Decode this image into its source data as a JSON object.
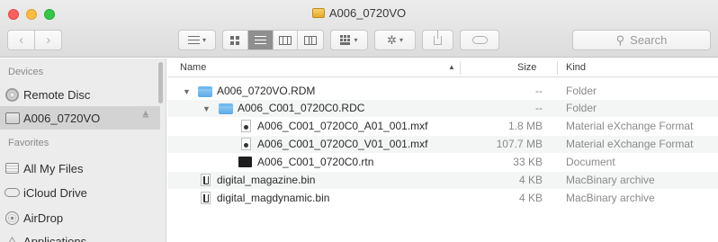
{
  "window": {
    "title": "A006_0720VO"
  },
  "toolbar": {
    "back_glyph": "‹",
    "forward_glyph": "›",
    "gear_glyph": "✲",
    "caret": "▾",
    "search_placeholder": "Search",
    "search_glyph": "⚲",
    "icons": [
      "back-icon",
      "forward-icon",
      "arrange-icon",
      "icon-view-icon",
      "list-view-icon",
      "column-view-icon",
      "cover-flow-icon",
      "group-icon",
      "gear-icon",
      "share-icon",
      "tag-icon",
      "search-icon"
    ]
  },
  "sidebar": {
    "devices_header": "Devices",
    "favorites_header": "Favorites",
    "eject_glyph": "≜",
    "devices": [
      {
        "label": "Remote Disc",
        "icon": "disc-icon"
      },
      {
        "label": "A006_0720VO",
        "icon": "drive-icon",
        "selected": true
      }
    ],
    "favorites": [
      {
        "label": "All My Files",
        "icon": "all-my-files-icon"
      },
      {
        "label": "iCloud Drive",
        "icon": "cloud-icon"
      },
      {
        "label": "AirDrop",
        "icon": "airdrop-icon"
      },
      {
        "label": "Applications",
        "icon": "applications-icon",
        "glyph": "⨺"
      }
    ]
  },
  "list": {
    "columns": {
      "name": "Name",
      "size": "Size",
      "kind": "Kind"
    },
    "sort_glyph": "▲",
    "expanded_glyph": "▼",
    "rows": [
      {
        "name": "A006_0720VO.RDM",
        "size": "--",
        "kind": "Folder",
        "icon": "folder-icon"
      },
      {
        "name": "A006_C001_0720C0.RDC",
        "size": "--",
        "kind": "Folder",
        "icon": "folder-icon"
      },
      {
        "name": "A006_C001_0720C0_A01_001.mxf",
        "size": "1.8 MB",
        "kind": "Material eXchange Format",
        "icon": "mxf-file-icon"
      },
      {
        "name": "A006_C001_0720C0_V01_001.mxf",
        "size": "107.7 MB",
        "kind": "Material eXchange Format",
        "icon": "mxf-file-icon"
      },
      {
        "name": "A006_C001_0720C0.rtn",
        "size": "33 KB",
        "kind": "Document",
        "icon": "document-icon"
      },
      {
        "name": "digital_magazine.bin",
        "size": "4 KB",
        "kind": "MacBinary archive",
        "icon": "macbinary-icon"
      },
      {
        "name": "digital_magdynamic.bin",
        "size": "4 KB",
        "kind": "MacBinary archive",
        "icon": "macbinary-icon"
      }
    ]
  },
  "colors": {
    "close": "#fc605c",
    "minimize": "#fdbc40",
    "maximize": "#34c84a",
    "folder": "#5aa9e6",
    "sidebar_selected": "#d3d3d3"
  }
}
